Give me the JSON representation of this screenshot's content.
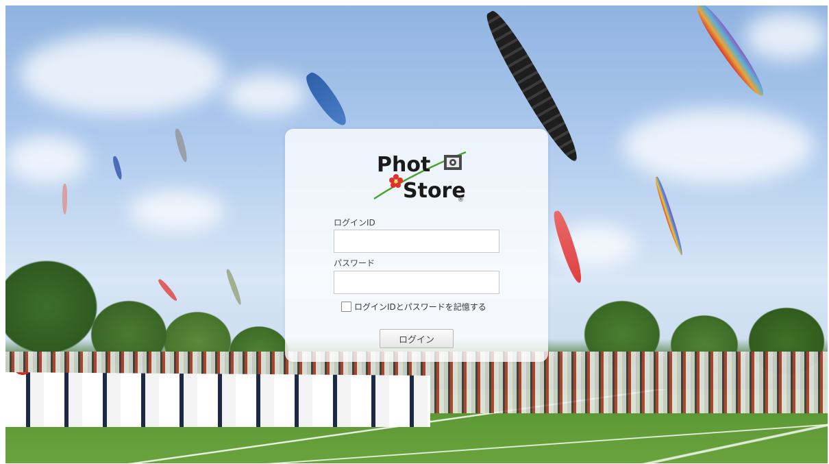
{
  "logo": {
    "line1": "Phot",
    "line2": "Store",
    "registered_mark": "®",
    "brand_colors": {
      "text": "#1a1a1a",
      "flower": "#e0322a",
      "stem": "#4aa32e"
    }
  },
  "login_form": {
    "id_label": "ログインID",
    "id_value": "",
    "password_label": "パスワード",
    "password_value": "",
    "remember_checked": false,
    "remember_label": "ログインIDとパスワードを記憶する",
    "submit_label": "ログイン"
  }
}
